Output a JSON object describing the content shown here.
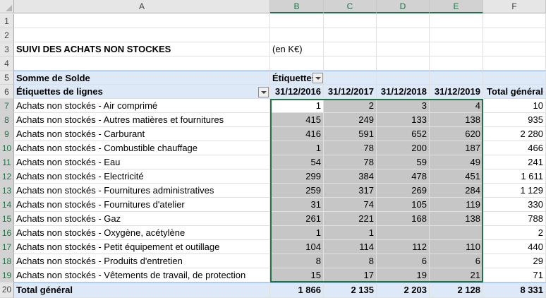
{
  "columns": [
    "A",
    "B",
    "C",
    "D",
    "E",
    "F"
  ],
  "row_numbers": [
    "1",
    "2",
    "3",
    "4",
    "5",
    "6",
    "7",
    "8",
    "9",
    "10",
    "11",
    "12",
    "13",
    "14",
    "15",
    "16",
    "17",
    "18",
    "19",
    "20"
  ],
  "title": "SUIVI DES ACHATS NON STOCKES",
  "unit": "(en K€)",
  "pivot": {
    "values_label": "Somme de Solde",
    "column_labels": "Étiquettes de colonnes",
    "row_labels": "Étiquettes de lignes",
    "headers": [
      "31/12/2016",
      "31/12/2017",
      "31/12/2018",
      "31/12/2019",
      "Total général"
    ],
    "rows": [
      {
        "label": "Achats non stockés - Air comprimé",
        "values": [
          "1",
          "2",
          "3",
          "4",
          "10"
        ]
      },
      {
        "label": "Achats non stockés - Autres matières et fournitures",
        "values": [
          "415",
          "249",
          "133",
          "138",
          "935"
        ]
      },
      {
        "label": "Achats non stockés - Carburant",
        "values": [
          "416",
          "591",
          "652",
          "620",
          "2 280"
        ]
      },
      {
        "label": "Achats non stockés - Combustible chauffage",
        "values": [
          "1",
          "78",
          "200",
          "187",
          "466"
        ]
      },
      {
        "label": "Achats non stockés - Eau",
        "values": [
          "54",
          "78",
          "59",
          "49",
          "241"
        ]
      },
      {
        "label": "Achats non stockés - Electricité",
        "values": [
          "299",
          "384",
          "478",
          "451",
          "1 611"
        ]
      },
      {
        "label": "Achats non stockés - Fournitures administratives",
        "values": [
          "259",
          "317",
          "269",
          "284",
          "1 129"
        ]
      },
      {
        "label": "Achats non stockés - Fournitures d'atelier",
        "values": [
          "31",
          "74",
          "105",
          "119",
          "330"
        ]
      },
      {
        "label": "Achats non stockés - Gaz",
        "values": [
          "261",
          "221",
          "168",
          "138",
          "788"
        ]
      },
      {
        "label": "Achats non stockés - Oxygène, acétylène",
        "values": [
          "1",
          "1",
          "",
          "",
          "2"
        ]
      },
      {
        "label": "Achats non stockés - Petit équipement et outillage",
        "values": [
          "104",
          "114",
          "112",
          "110",
          "440"
        ]
      },
      {
        "label": "Achats non stockés - Produits d'entretien",
        "values": [
          "8",
          "8",
          "6",
          "6",
          "29"
        ]
      },
      {
        "label": "Achats non stockés - Vêtements de travail, de protection",
        "values": [
          "15",
          "17",
          "19",
          "21",
          "71"
        ]
      }
    ],
    "total": {
      "label": "Total général",
      "values": [
        "1 866",
        "2 135",
        "2 203",
        "2 128",
        "8 331"
      ]
    }
  }
}
